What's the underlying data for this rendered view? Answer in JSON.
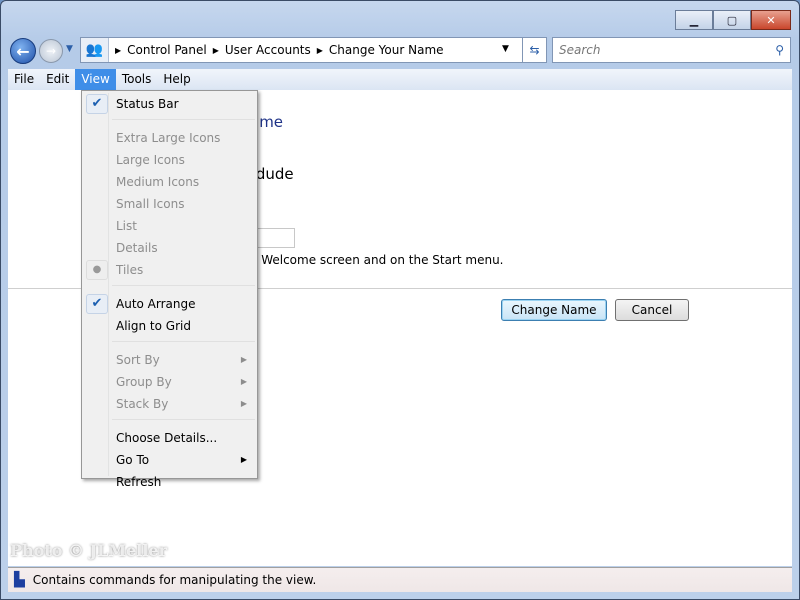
{
  "window": {
    "minimize": "▁",
    "maximize": "▢",
    "close": "✕"
  },
  "nav": {
    "back": "←",
    "forward": "→",
    "breadcrumbs": [
      "Control Panel",
      "User Accounts",
      "Change Your Name"
    ],
    "search_placeholder": "Search"
  },
  "menubar": [
    "File",
    "Edit",
    "View",
    "Tools",
    "Help"
  ],
  "content": {
    "title": "ame",
    "username": "tdude",
    "info": "e Welcome screen and on the Start menu.",
    "change_name": "Change Name",
    "cancel": "Cancel"
  },
  "view_menu": {
    "g1": [
      {
        "label": "Status Bar",
        "checked": true
      }
    ],
    "g2": [
      "Extra Large Icons",
      "Large Icons",
      "Medium Icons",
      "Small Icons",
      "List",
      "Details",
      "Tiles"
    ],
    "g3": [
      "Auto Arrange",
      "Align to Grid"
    ],
    "g4": [
      "Sort By",
      "Group By",
      "Stack By"
    ],
    "g5": [
      "Choose Details...",
      "Go To",
      "Refresh"
    ]
  },
  "status": {
    "text": "Contains commands for manipulating the view."
  },
  "watermark": "Photo © JLMeller"
}
